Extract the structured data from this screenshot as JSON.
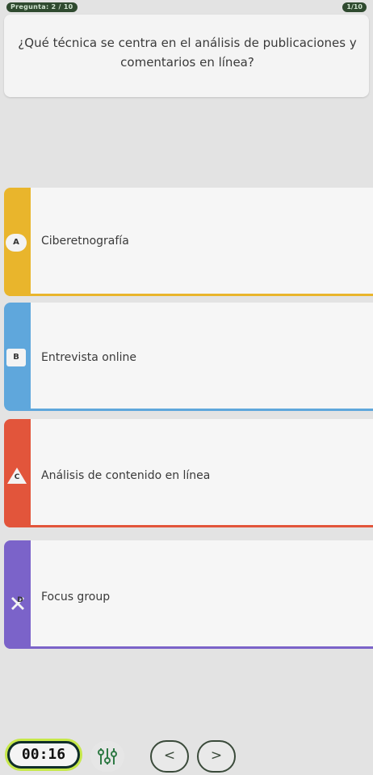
{
  "header": {
    "question_counter": "Pregunta: 2 / 10",
    "score": "1/10"
  },
  "question": {
    "text": "¿Qué técnica se centra en el análisis de publicaciones y comentarios en línea?"
  },
  "answers": [
    {
      "letter": "A",
      "label": "Ciberetnografía",
      "color": "#e9b52c"
    },
    {
      "letter": "B",
      "label": "Entrevista online",
      "color": "#5fa7dc"
    },
    {
      "letter": "C",
      "label": "Análisis de contenido en línea",
      "color": "#e2553b"
    },
    {
      "letter": "D",
      "label": "Focus group",
      "color": "#7b63c9"
    }
  ],
  "footer": {
    "timer": "00:16",
    "settings_icon": "equalizer-icon",
    "prev_label": "<",
    "next_label": ">"
  },
  "colors": {
    "timer_ring": "#c6e84a",
    "timer_bg": "#0f2e2a"
  }
}
